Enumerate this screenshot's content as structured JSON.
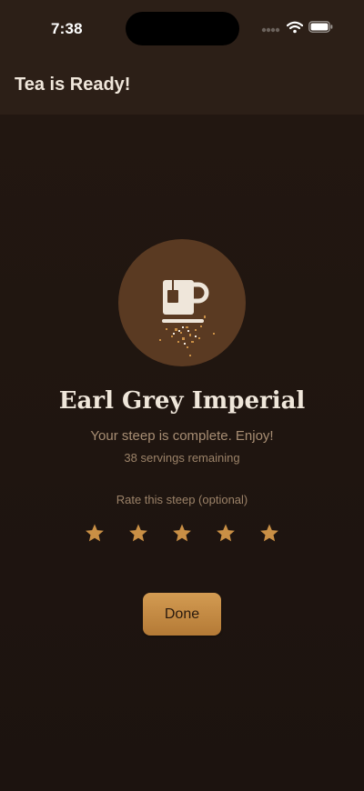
{
  "status_bar": {
    "time": "7:38",
    "icons": [
      "cellular-dots-icon",
      "wifi-icon",
      "battery-icon"
    ]
  },
  "app_bar": {
    "title": "Tea is Ready!"
  },
  "main": {
    "icon": "teacup-icon",
    "tea_name": "Earl Grey Imperial",
    "subtitle": "Your steep is complete. Enjoy!",
    "servings": "38 servings remaining",
    "rating": {
      "label": "Rate this steep (optional)",
      "max_stars": 5,
      "selected": 0
    },
    "done_label": "Done"
  },
  "colors": {
    "background": "#1e1410",
    "app_bar": "#2c1f17",
    "accent": "#c98f45",
    "circle": "#5a3a22",
    "text_primary": "#efe6da",
    "text_secondary": "#a78d73"
  }
}
